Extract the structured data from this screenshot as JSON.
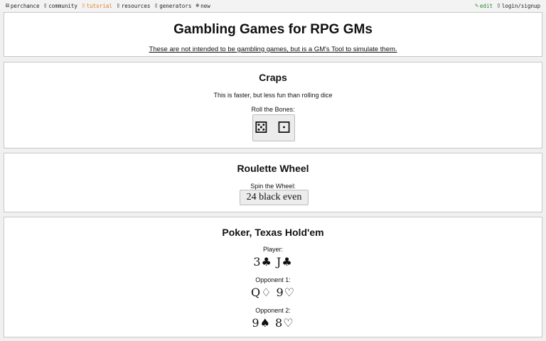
{
  "nav": {
    "left": [
      {
        "icon": "dice-icon",
        "glyph": "⚄",
        "label": "perchance"
      },
      {
        "icon": "community-icon",
        "glyph": "▯",
        "label": "community"
      },
      {
        "icon": "tutorial-icon",
        "glyph": "▯",
        "label": "tutorial"
      },
      {
        "icon": "resources-icon",
        "glyph": "▯",
        "label": "resources"
      },
      {
        "icon": "generators-icon",
        "glyph": "▯",
        "label": "generators"
      },
      {
        "icon": "new-icon",
        "glyph": "⊕",
        "label": "new"
      }
    ],
    "right": [
      {
        "icon": "edit-icon",
        "glyph": "✎",
        "label": "edit"
      },
      {
        "icon": "login-icon",
        "glyph": "▯",
        "label": "login/signup"
      }
    ]
  },
  "header": {
    "title": "Gambling Games for RPG GMs",
    "subtitle": "These are not intended to be gambling games, but is a GM's Tool to simulate them."
  },
  "craps": {
    "title": "Craps",
    "description": "This is faster, but less fun than rolling dice",
    "prompt": "Roll the Bones:",
    "dice": "⚄ ⚀"
  },
  "roulette": {
    "title": "Roulette Wheel",
    "prompt": "Spin the Wheel:",
    "result": "24 black even"
  },
  "poker": {
    "title": "Poker, Texas Hold'em",
    "player_label": "Player:",
    "player_cards": "3♣ J♣",
    "opponent1_label": "Opponent 1:",
    "opponent1_cards": "Q♢ 9♡",
    "opponent2_label": "Opponent 2:",
    "opponent2_cards": "9♠ 8♡"
  },
  "colors": {
    "tutorial": "#e0801f",
    "edit": "#2a8a2a"
  }
}
